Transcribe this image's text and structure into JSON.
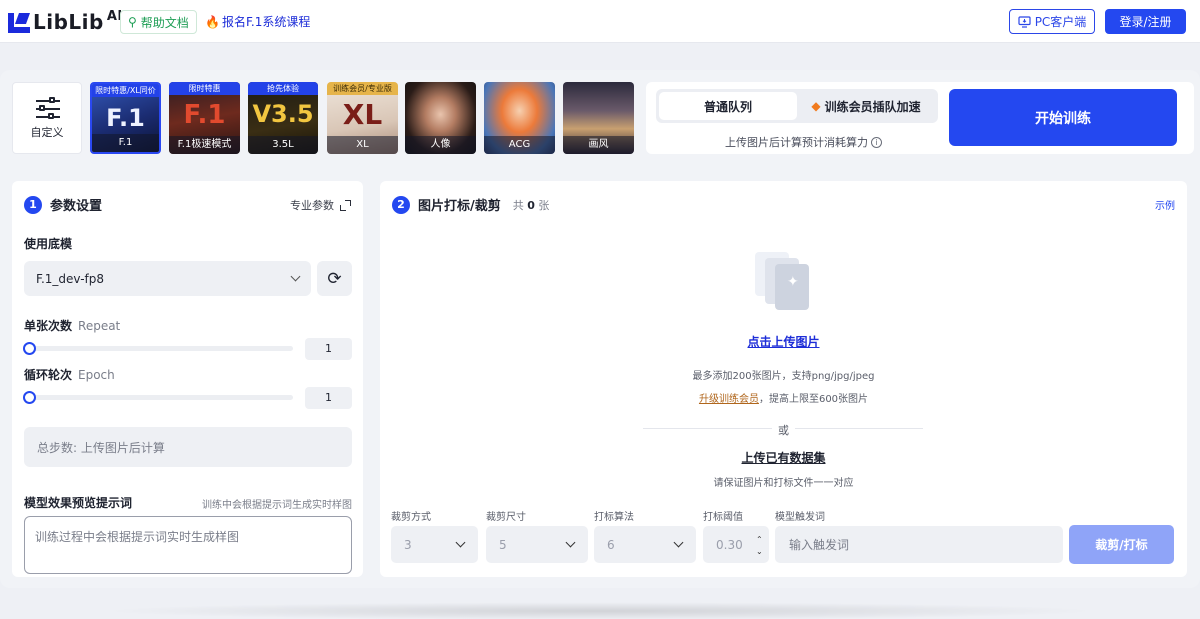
{
  "header": {
    "logo_text": "LibLib",
    "logo_ai": "AI",
    "help_label": "帮助文档",
    "course_label": "报名F.1系统课程",
    "pc_label": "PC客户端",
    "login_label": "登录/注册"
  },
  "models": {
    "custom_label": "自定义",
    "items": [
      {
        "tag": "限时特惠/XL同价",
        "big": "F.1",
        "caption": "F.1",
        "selected": true
      },
      {
        "tag": "限时特惠",
        "big": "F.1",
        "caption": "F.1极速模式",
        "selected": false
      },
      {
        "tag": "抢先体验",
        "big": "V3.5",
        "caption": "3.5L",
        "selected": false
      },
      {
        "tag": "训练会员/专业版",
        "big": "XL",
        "caption": "XL",
        "selected": false
      },
      {
        "tag": "",
        "big": "",
        "caption": "人像",
        "selected": false
      },
      {
        "tag": "",
        "big": "",
        "caption": "ACG",
        "selected": false
      },
      {
        "tag": "",
        "big": "",
        "caption": "画风",
        "selected": false
      }
    ]
  },
  "queue": {
    "normal_label": "普通队列",
    "vip_label": "训练会员插队加速",
    "note": "上传图片后计算预计消耗算力",
    "start_label": "开始训练"
  },
  "params": {
    "step": "1",
    "title": "参数设置",
    "pro_label": "专业参数",
    "base_model_label": "使用底模",
    "base_model_value": "F.1_dev-fp8",
    "repeat_label": "单张次数",
    "repeat_en": "Repeat",
    "repeat_value": "1",
    "epoch_label": "循环轮次",
    "epoch_en": "Epoch",
    "epoch_value": "1",
    "total_steps": "总步数: 上传图片后计算",
    "preview_label": "模型效果预览提示词",
    "preview_hint": "训练中会根据提示词生成实时样图",
    "preview_placeholder": "训练过程中会根据提示词实时生成样图"
  },
  "images": {
    "step": "2",
    "title": "图片打标/裁剪",
    "count_label": "共",
    "count": "0",
    "count_unit": "张",
    "example_label": "示例",
    "upload_link": "点击上传图片",
    "upload_note": "最多添加200张图片，支持png/jpg/jpeg",
    "upgrade_link": "升级训练会员",
    "upgrade_note": "，提高上限至600张图片",
    "or": "或",
    "dataset_link": "上传已有数据集",
    "dataset_note": "请保证图片和打标文件一一对应",
    "crop_mode_label": "裁剪方式",
    "crop_mode_value": "3",
    "crop_size_label": "裁剪尺寸",
    "crop_size_value": "5",
    "tag_algo_label": "打标算法",
    "tag_algo_value": "6",
    "threshold_label": "打标阈值",
    "threshold_value": "0.30",
    "trigger_label": "模型触发词",
    "trigger_placeholder": "输入触发词",
    "crop_button": "裁剪/打标"
  },
  "colors": {
    "accent": "#2448f0",
    "accent_light": "#8fa4f8",
    "help_green": "#1e9e55",
    "fire": "#f4602a"
  }
}
